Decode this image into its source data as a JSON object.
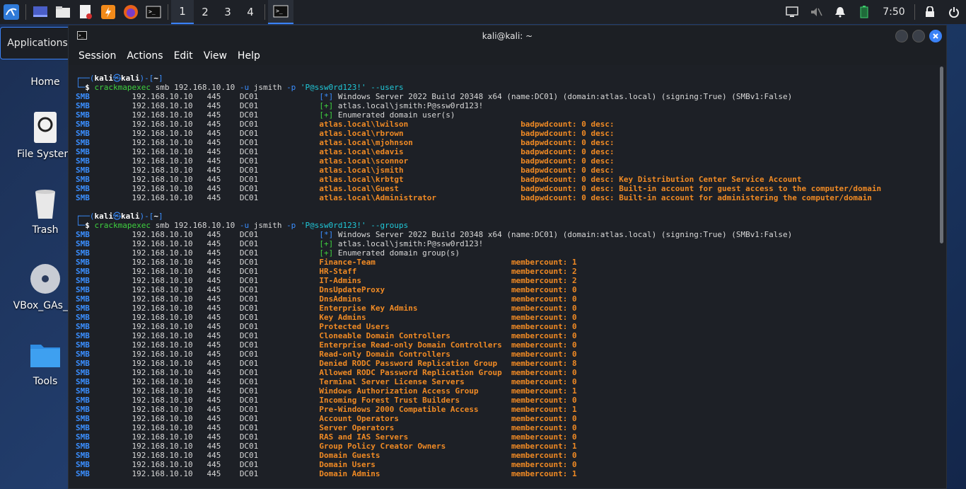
{
  "panel": {
    "workspaces": [
      "1",
      "2",
      "3",
      "4"
    ],
    "clock": "7:50"
  },
  "apps_tooltip": "Applications",
  "desktop": [
    {
      "label": "Home",
      "icon": "home-folder-icon"
    },
    {
      "label": "File System",
      "icon": "drive-icon"
    },
    {
      "label": "Trash",
      "icon": "trash-icon"
    },
    {
      "label": "VBox_GAs_...",
      "icon": "cdrom-icon"
    },
    {
      "label": "Tools",
      "icon": "folder-icon"
    }
  ],
  "window": {
    "title": "kali@kali: ~",
    "menu": [
      "Session",
      "Actions",
      "Edit",
      "View",
      "Help"
    ]
  },
  "terminal": {
    "prompt_user": "kali",
    "prompt_host": "kali",
    "prompt_dir": "~",
    "proto": "SMB",
    "ip": "192.168.10.10",
    "port": "445",
    "host": "DC01",
    "users_cmd": {
      "bin": "crackmapexec",
      "args1": " smb 192.168.10.10 ",
      "flag_u": "-u",
      "user": " jsmith ",
      "flag_p": "-p",
      "pass": " 'P@ssw0rd123!'",
      "opt": " --users"
    },
    "groups_cmd": {
      "bin": "crackmapexec",
      "args1": " smb 192.168.10.10 ",
      "flag_u": "-u",
      "user": " jsmith ",
      "flag_p": "-p",
      "pass": " 'P@ssw0rd123!'",
      "opt": " --groups"
    },
    "info_lines": [
      {
        "mark": "[*]",
        "text": " Windows Server 2022 Build 20348 x64 (name:DC01) (domain:atlas.local) (signing:True) (SMBv1:False)"
      },
      {
        "mark": "[+]",
        "text": " atlas.local\\jsmith:P@ssw0rd123!"
      }
    ],
    "users_enum": {
      "mark": "[+]",
      "text": " Enumerated domain user(s)"
    },
    "groups_enum": {
      "mark": "[+]",
      "text": " Enumerated domain group(s)"
    },
    "users": [
      {
        "name": "atlas.local\\lwilson",
        "desc": "badpwdcount: 0 desc:"
      },
      {
        "name": "atlas.local\\rbrown",
        "desc": "badpwdcount: 0 desc:"
      },
      {
        "name": "atlas.local\\mjohnson",
        "desc": "badpwdcount: 0 desc:"
      },
      {
        "name": "atlas.local\\edavis",
        "desc": "badpwdcount: 0 desc:"
      },
      {
        "name": "atlas.local\\sconnor",
        "desc": "badpwdcount: 0 desc:"
      },
      {
        "name": "atlas.local\\jsmith",
        "desc": "badpwdcount: 0 desc:"
      },
      {
        "name": "atlas.local\\krbtgt",
        "desc": "badpwdcount: 0 desc: Key Distribution Center Service Account"
      },
      {
        "name": "atlas.local\\Guest",
        "desc": "badpwdcount: 0 desc: Built-in account for guest access to the computer/domain"
      },
      {
        "name": "atlas.local\\Administrator",
        "desc": "badpwdcount: 0 desc: Built-in account for administering the computer/domain"
      }
    ],
    "groups": [
      {
        "name": "Finance-Team",
        "count": "membercount: 1"
      },
      {
        "name": "HR-Staff",
        "count": "membercount: 2"
      },
      {
        "name": "IT-Admins",
        "count": "membercount: 2"
      },
      {
        "name": "DnsUpdateProxy",
        "count": "membercount: 0"
      },
      {
        "name": "DnsAdmins",
        "count": "membercount: 0"
      },
      {
        "name": "Enterprise Key Admins",
        "count": "membercount: 0"
      },
      {
        "name": "Key Admins",
        "count": "membercount: 0"
      },
      {
        "name": "Protected Users",
        "count": "membercount: 0"
      },
      {
        "name": "Cloneable Domain Controllers",
        "count": "membercount: 0"
      },
      {
        "name": "Enterprise Read-only Domain Controllers",
        "count": "membercount: 0"
      },
      {
        "name": "Read-only Domain Controllers",
        "count": "membercount: 0"
      },
      {
        "name": "Denied RODC Password Replication Group",
        "count": "membercount: 8"
      },
      {
        "name": "Allowed RODC Password Replication Group",
        "count": "membercount: 0"
      },
      {
        "name": "Terminal Server License Servers",
        "count": "membercount: 0"
      },
      {
        "name": "Windows Authorization Access Group",
        "count": "membercount: 1"
      },
      {
        "name": "Incoming Forest Trust Builders",
        "count": "membercount: 0"
      },
      {
        "name": "Pre-Windows 2000 Compatible Access",
        "count": "membercount: 1"
      },
      {
        "name": "Account Operators",
        "count": "membercount: 0"
      },
      {
        "name": "Server Operators",
        "count": "membercount: 0"
      },
      {
        "name": "RAS and IAS Servers",
        "count": "membercount: 0"
      },
      {
        "name": "Group Policy Creator Owners",
        "count": "membercount: 1"
      },
      {
        "name": "Domain Guests",
        "count": "membercount: 0"
      },
      {
        "name": "Domain Users",
        "count": "membercount: 0"
      },
      {
        "name": "Domain Admins",
        "count": "membercount: 1"
      }
    ]
  }
}
